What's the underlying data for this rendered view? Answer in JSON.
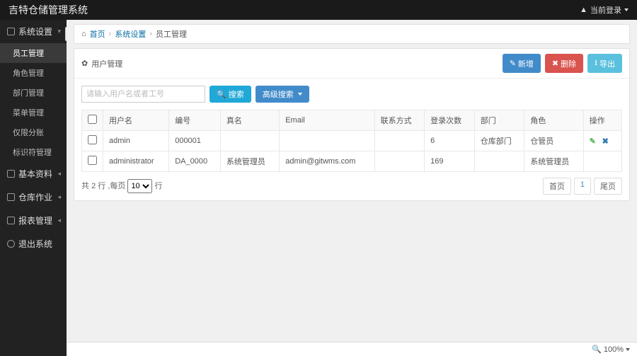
{
  "navbar": {
    "brand": "吉特仓储管理系统",
    "login_label": "当前登录"
  },
  "sidebar": {
    "groups": [
      {
        "title": "系统设置",
        "expanded": true,
        "items": [
          "员工管理",
          "角色管理",
          "部门管理",
          "菜单管理",
          "仅限分账",
          "标识符管理"
        ],
        "active_index": 0
      },
      {
        "title": "基本资料",
        "expanded": false
      },
      {
        "title": "仓库作业",
        "expanded": false
      },
      {
        "title": "报表管理",
        "expanded": false
      },
      {
        "title": "退出系统",
        "expanded": false,
        "is_exit": true
      }
    ]
  },
  "breadcrumb": {
    "home": "首页",
    "mid": "系统设置",
    "current": "员工管理"
  },
  "panel": {
    "title": "用户管理",
    "actions": {
      "add": "新增",
      "delete": "删除",
      "export": "导出"
    }
  },
  "search": {
    "placeholder": "请输入用户名或者工号",
    "search_btn": "搜索",
    "advanced_btn": "高级搜索"
  },
  "table": {
    "headers": [
      "用户名",
      "编号",
      "真名",
      "Email",
      "联系方式",
      "登录次数",
      "部门",
      "角色",
      "操作"
    ],
    "rows": [
      {
        "username": "admin",
        "code": "000001",
        "realname": "",
        "email": "",
        "contact": "",
        "logins": "6",
        "dept": "仓库部门",
        "role": "仓管员"
      },
      {
        "username": "administrator",
        "code": "DA_0000",
        "realname": "系统管理员",
        "email": "admin@gitwms.com",
        "contact": "",
        "logins": "169",
        "dept": "",
        "role": "系统管理员"
      }
    ]
  },
  "footer": {
    "summary_prefix": "共",
    "summary_count": "2",
    "summary_mid": "行 ,每页",
    "summary_suffix": "行",
    "rows_per_page": "10",
    "first": "首页",
    "page": "1",
    "last": "尾页"
  },
  "status": {
    "zoom": "100%"
  }
}
